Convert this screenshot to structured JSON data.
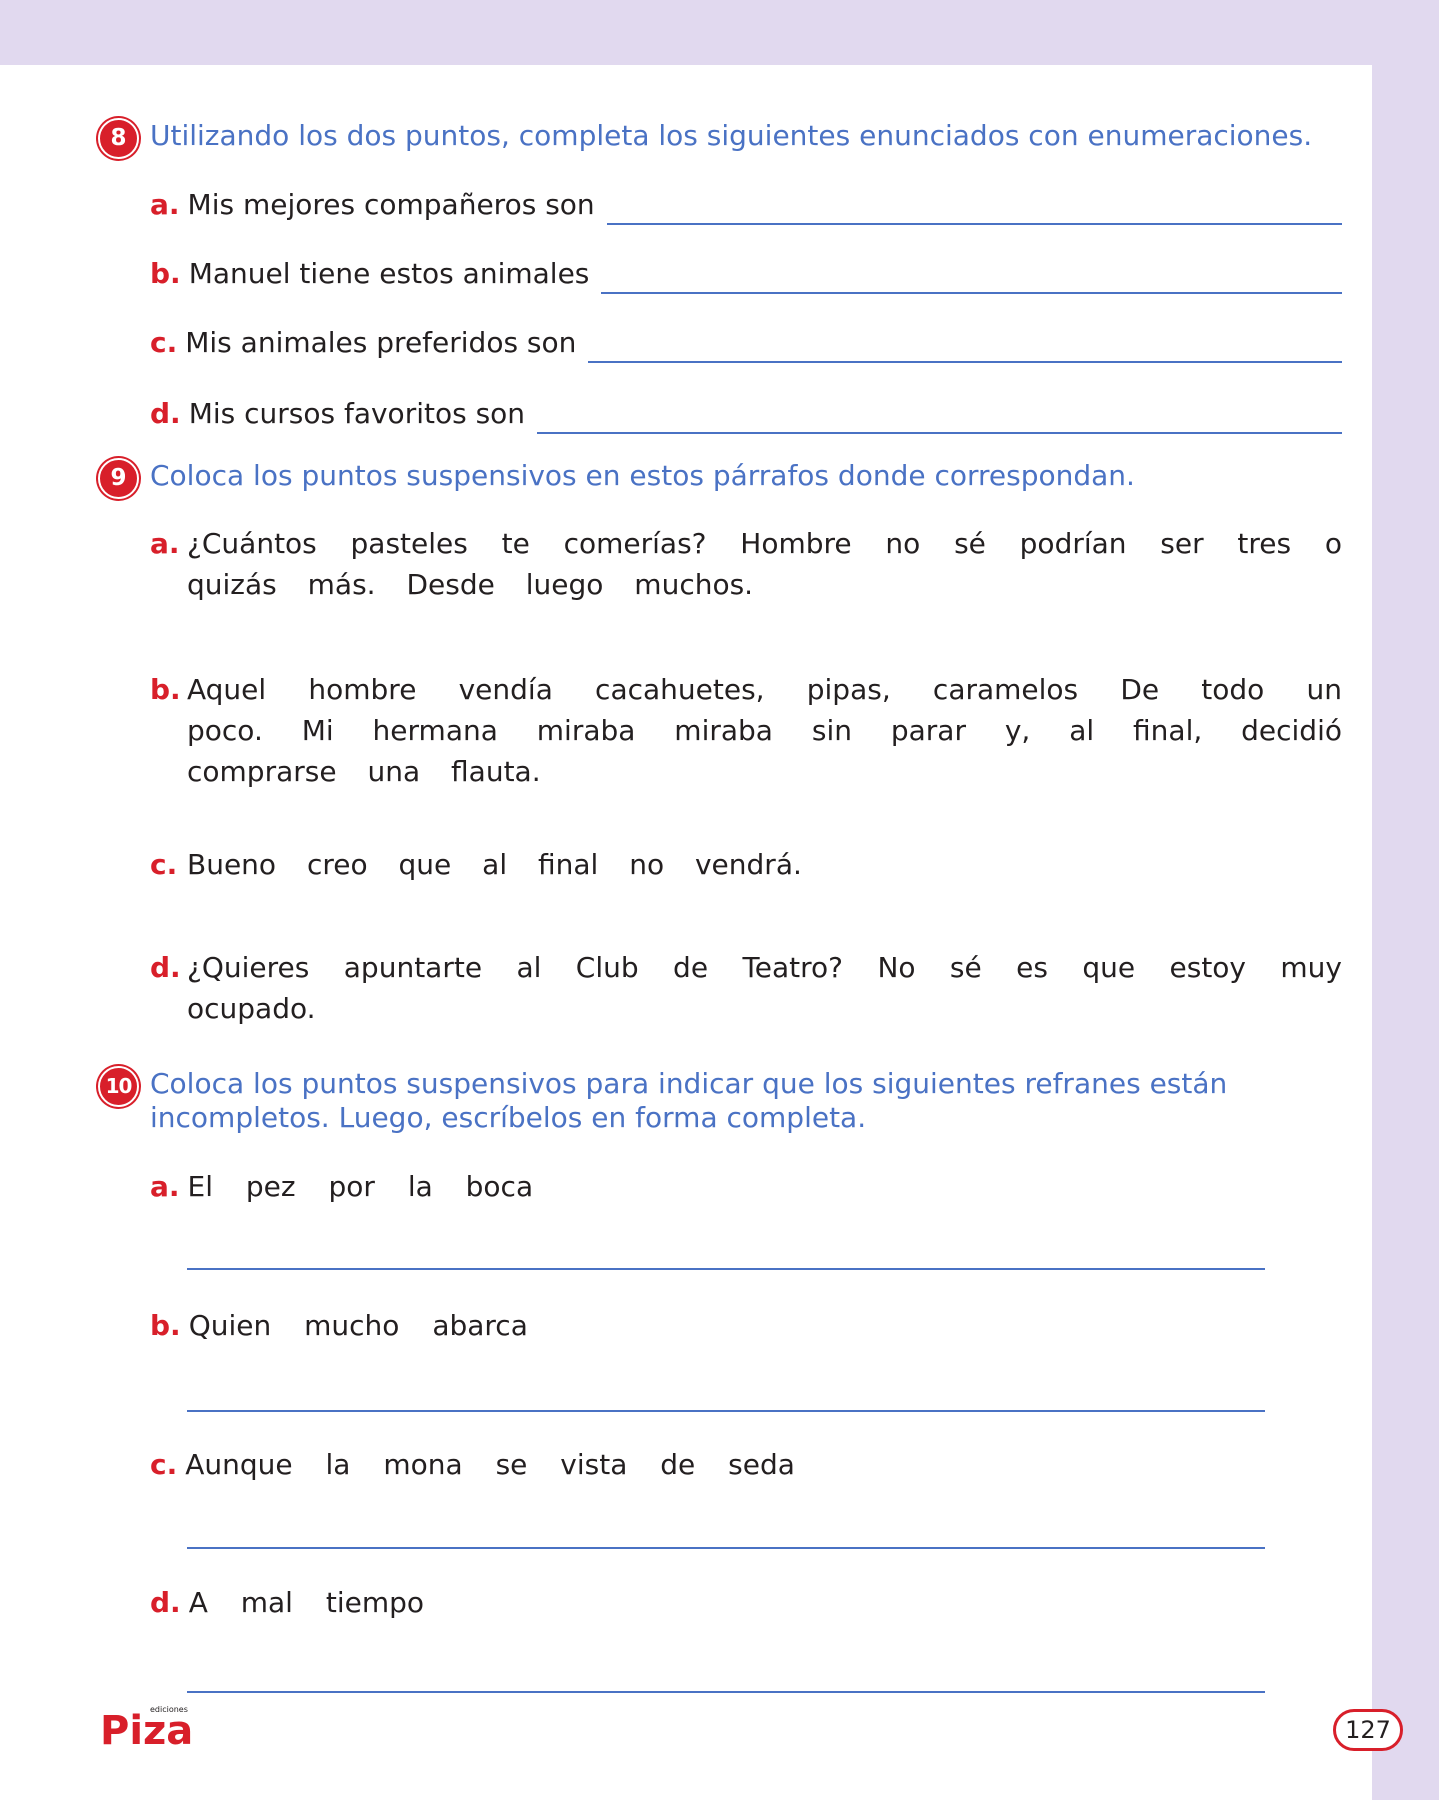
{
  "q8": {
    "number": "8",
    "title": "Utilizando los dos puntos, completa los siguientes enunciados con enumeraciones.",
    "items": [
      {
        "letter": "a.",
        "text": "Mis mejores compañeros son"
      },
      {
        "letter": "b.",
        "text": "Manuel tiene estos animales"
      },
      {
        "letter": "c.",
        "text": "Mis animales preferidos son"
      },
      {
        "letter": "d.",
        "text": "Mis cursos favoritos son"
      }
    ]
  },
  "q9": {
    "number": "9",
    "title": "Coloca los puntos suspensivos en estos párrafos donde correspondan.",
    "items": [
      {
        "letter": "a.",
        "text": "¿Cuántos pasteles te comerías? Hombre no sé podrían ser tres o quizás más. Desde luego muchos."
      },
      {
        "letter": "b.",
        "text": "Aquel hombre vendía cacahuetes, pipas, caramelos De todo un poco. Mi hermana miraba miraba sin parar y, al final, decidió comprarse una flauta."
      },
      {
        "letter": "c.",
        "text": "Bueno creo que al final no vendrá."
      },
      {
        "letter": "d.",
        "text": "¿Quieres apuntarte al Club de Teatro? No sé es que estoy muy ocupado."
      }
    ]
  },
  "q10": {
    "number": "10",
    "title": "Coloca los puntos suspensivos para indicar que los siguientes refranes están incompletos. Luego, escríbelos en forma completa.",
    "items": [
      {
        "letter": "a.",
        "text": "El pez por la boca"
      },
      {
        "letter": "b.",
        "text": "Quien mucho abarca"
      },
      {
        "letter": "c.",
        "text": "Aunque la mona se vista de seda"
      },
      {
        "letter": "d.",
        "text": "A mal tiempo"
      }
    ]
  },
  "footer": {
    "brand": "Piza",
    "brand_small": "ediciones",
    "page_number": "127"
  },
  "colors": {
    "accent_red": "#d81f2a",
    "title_blue": "#4a72c4",
    "band_lavender": "#e1d9ef"
  }
}
